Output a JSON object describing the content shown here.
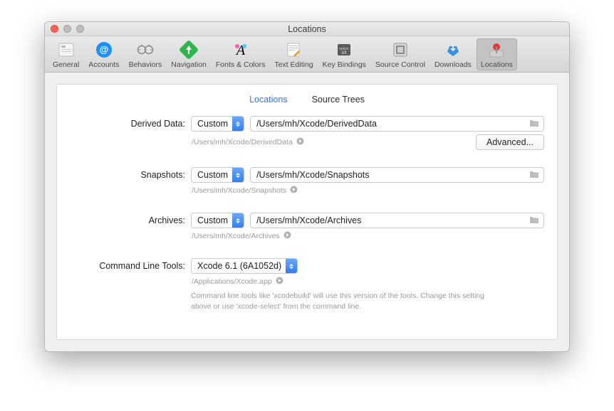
{
  "window": {
    "title": "Locations"
  },
  "toolbar": {
    "items": [
      {
        "label": "General"
      },
      {
        "label": "Accounts"
      },
      {
        "label": "Behaviors"
      },
      {
        "label": "Navigation"
      },
      {
        "label": "Fonts & Colors"
      },
      {
        "label": "Text Editing"
      },
      {
        "label": "Key Bindings"
      },
      {
        "label": "Source Control"
      },
      {
        "label": "Downloads"
      },
      {
        "label": "Locations"
      }
    ],
    "selected": "Locations"
  },
  "tabs": {
    "items": [
      "Locations",
      "Source Trees"
    ],
    "active": "Locations"
  },
  "rows": {
    "derived": {
      "label": "Derived Data:",
      "select": "Custom",
      "path": "/Users/mh/Xcode/DerivedData",
      "subpath": "/Users/mh/Xcode/DerivedData",
      "advanced": "Advanced..."
    },
    "snapshots": {
      "label": "Snapshots:",
      "select": "Custom",
      "path": "/Users/mh/Xcode/Snapshots",
      "subpath": "/Users/mh/Xcode/Snapshots"
    },
    "archives": {
      "label": "Archives:",
      "select": "Custom",
      "path": "/Users/mh/Xcode/Archives",
      "subpath": "/Users/mh/Xcode/Archives"
    },
    "clt": {
      "label": "Command Line Tools:",
      "select": "Xcode 6.1 (6A1052d)",
      "subpath": "/Applications/Xcode.app",
      "hint": "Command line tools like 'xcodebuild' will use this version of the tools. Change this setting above or use 'xcode-select' from the command line."
    }
  }
}
